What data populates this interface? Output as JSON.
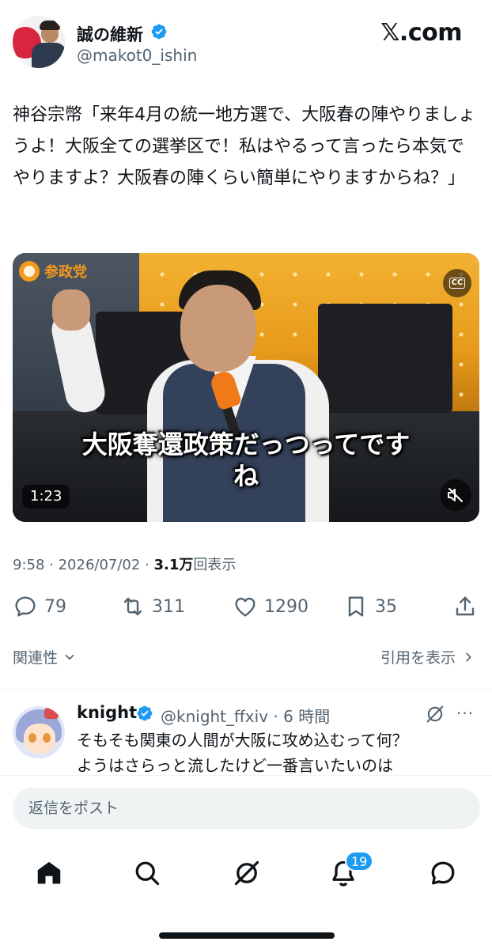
{
  "post": {
    "author": {
      "display_name": "誠の維新",
      "handle": "@makot0_ishin",
      "verified": true
    },
    "brand": "𝕏.com",
    "text": "神谷宗幣「来年4月の統一地方選で、大阪春の陣やりましょうよ！大阪全ての選挙区で！私はやるって言ったら本気でやりますよ？大阪春の陣くらい簡単にやりますからね？」",
    "video": {
      "overlay_logo": "参政党",
      "cc_label": "CC",
      "caption": "大阪奪還政策だっつってです\nね",
      "duration": "1:23"
    },
    "meta": {
      "time": "9:58",
      "separator": " · ",
      "date": "2026/07/02",
      "views_count": "3.1万",
      "views_label": "回表示"
    },
    "actions": {
      "replies": "79",
      "reposts": "311",
      "likes": "1290",
      "bookmarks": "35"
    },
    "related_label": "関連性",
    "quotes_label": "引用を表示"
  },
  "reply": {
    "display_name": "knight",
    "handle_time": "@knight_ffxiv · 6 時間",
    "text": "そもそも関東の人間が大阪に攻め込むって何？\nようはさらっと流したけど一番言いたいのは",
    "more": "···"
  },
  "composer": {
    "placeholder": "返信をポスト"
  },
  "bottom_nav": {
    "items": [
      "home-icon",
      "search-icon",
      "grok-icon",
      "notifications-icon",
      "messages-icon"
    ],
    "notifications_badge": "19"
  },
  "colors": {
    "accent": "#1d9bf0",
    "text": "#0f1419",
    "secondary": "#536471",
    "composer_bg": "#eff3f4"
  }
}
